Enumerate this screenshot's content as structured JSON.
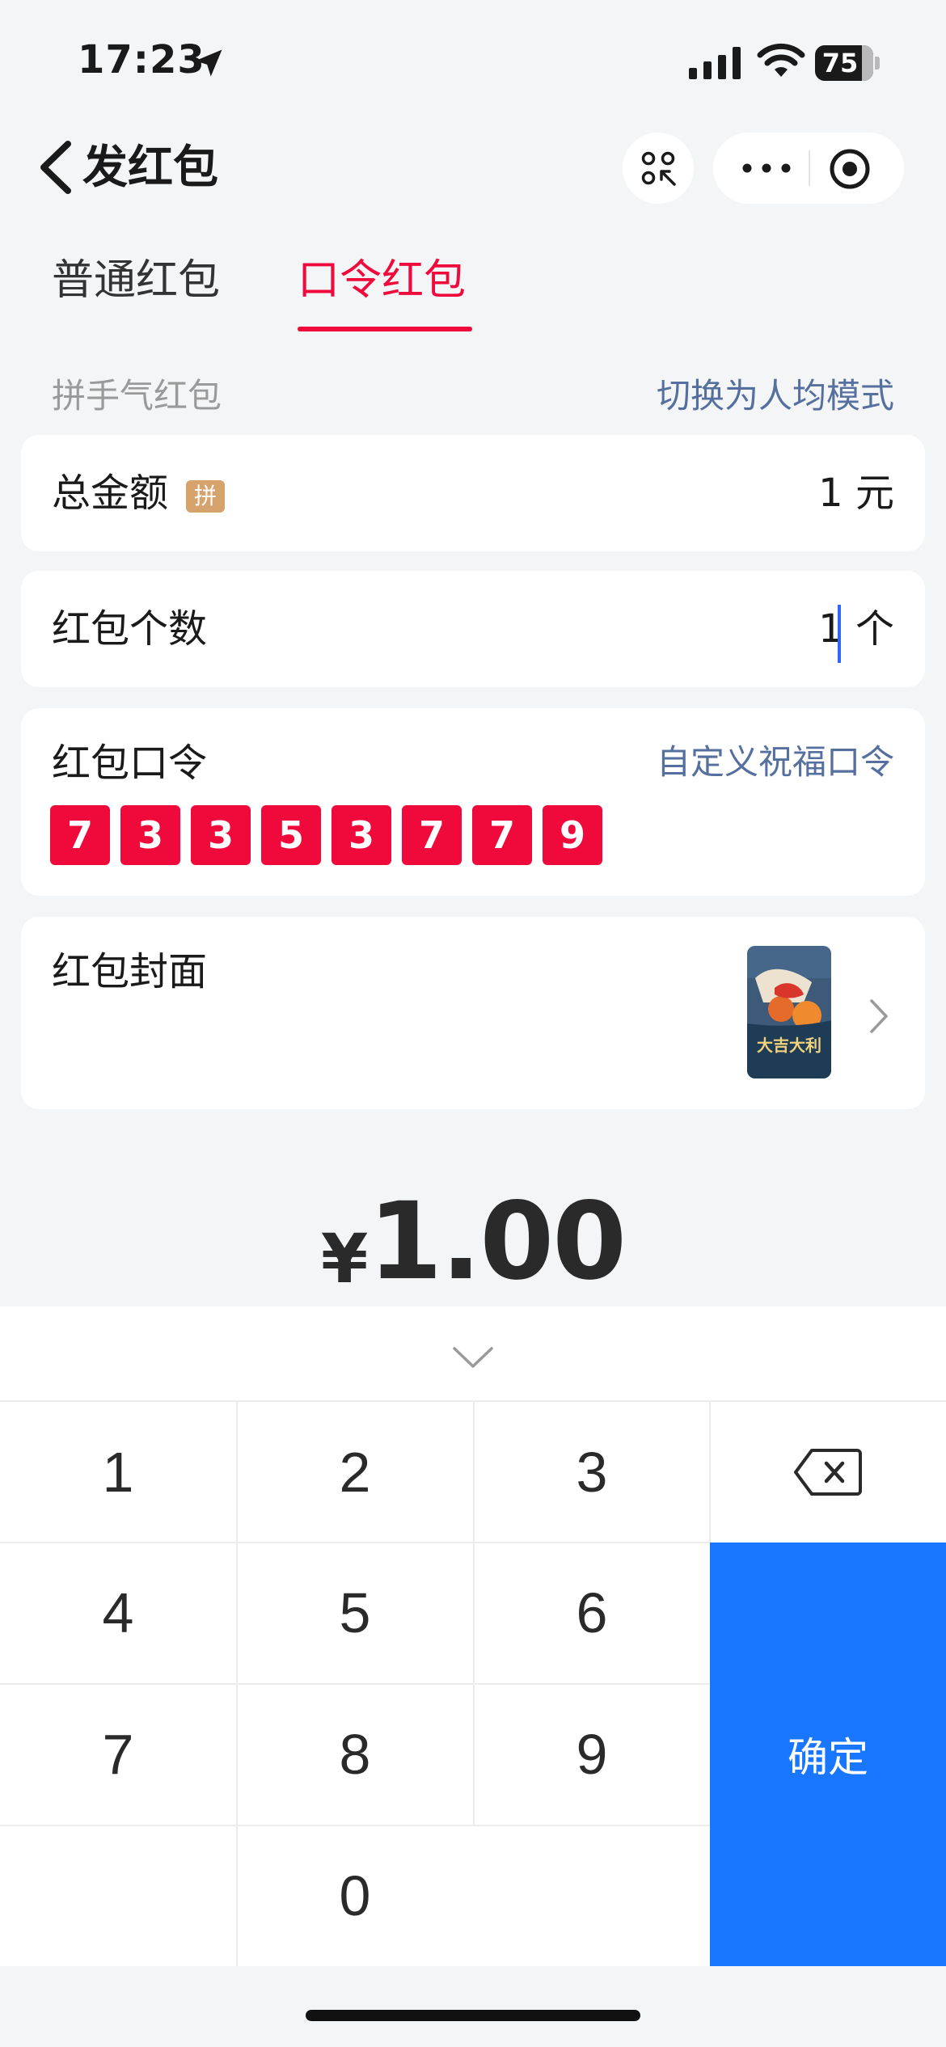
{
  "status_bar": {
    "time": "17:23",
    "battery": "75"
  },
  "nav": {
    "title": "发红包"
  },
  "tabs": [
    {
      "label": "普通红包",
      "active": false
    },
    {
      "label": "口令红包",
      "active": true
    }
  ],
  "mode": {
    "label": "拼手气红包",
    "switch_label": "切换为人均模式"
  },
  "total_card": {
    "label": "总金额",
    "badge": "拼",
    "value": "1",
    "unit": "元"
  },
  "count_card": {
    "label": "红包个数",
    "value": "1",
    "unit": "个"
  },
  "code_card": {
    "label": "红包口令",
    "link": "自定义祝福口令",
    "digits": [
      "7",
      "3",
      "3",
      "5",
      "3",
      "7",
      "7",
      "9"
    ]
  },
  "cover_card": {
    "label": "红包封面",
    "cover_text": "大吉大利"
  },
  "total": {
    "currency": "¥",
    "amount": "1.00"
  },
  "keypad": {
    "keys": [
      "1",
      "2",
      "3",
      "4",
      "5",
      "6",
      "7",
      "8",
      "9",
      "0"
    ],
    "confirm_label": "确定"
  },
  "colors": {
    "accent_red": "#f00a3c",
    "link_blue": "#55709f",
    "confirm_blue": "#1977ff",
    "badge_gold": "#d6a36c"
  }
}
